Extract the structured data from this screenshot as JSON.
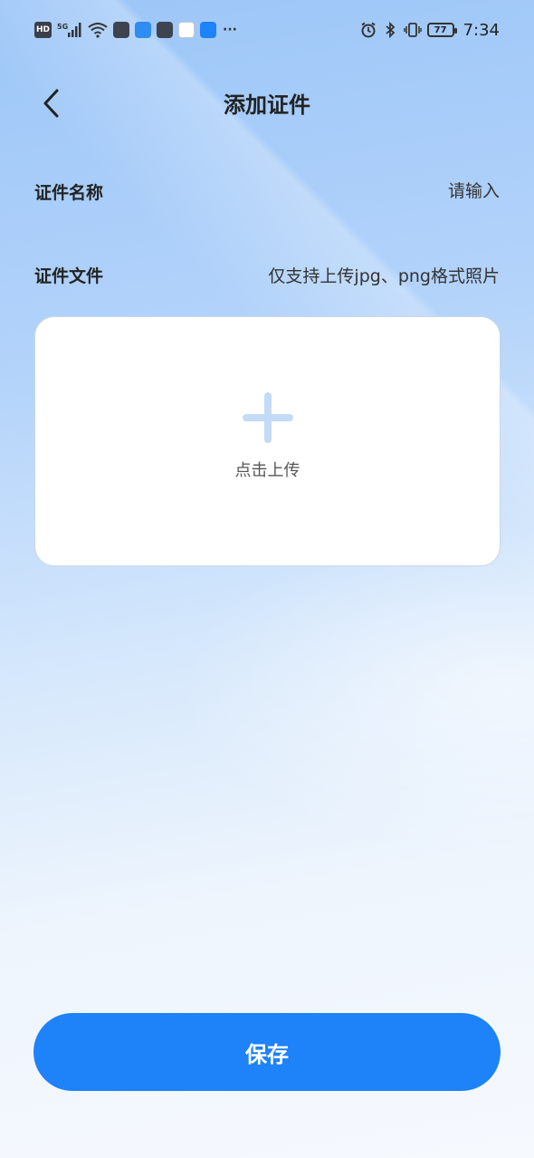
{
  "status_bar": {
    "hd": "HD",
    "network": "5G",
    "battery": "77",
    "time": "7:34",
    "more": "···"
  },
  "header": {
    "title": "添加证件"
  },
  "form": {
    "name": {
      "label": "证件名称",
      "placeholder": "请输入",
      "value": ""
    },
    "file": {
      "label": "证件文件",
      "hint": "仅支持上传jpg、png格式照片"
    }
  },
  "upload": {
    "label": "点击上传"
  },
  "footer": {
    "save_label": "保存"
  },
  "colors": {
    "accent": "#1e82f8",
    "plus_icon": "#c3dbf6"
  }
}
